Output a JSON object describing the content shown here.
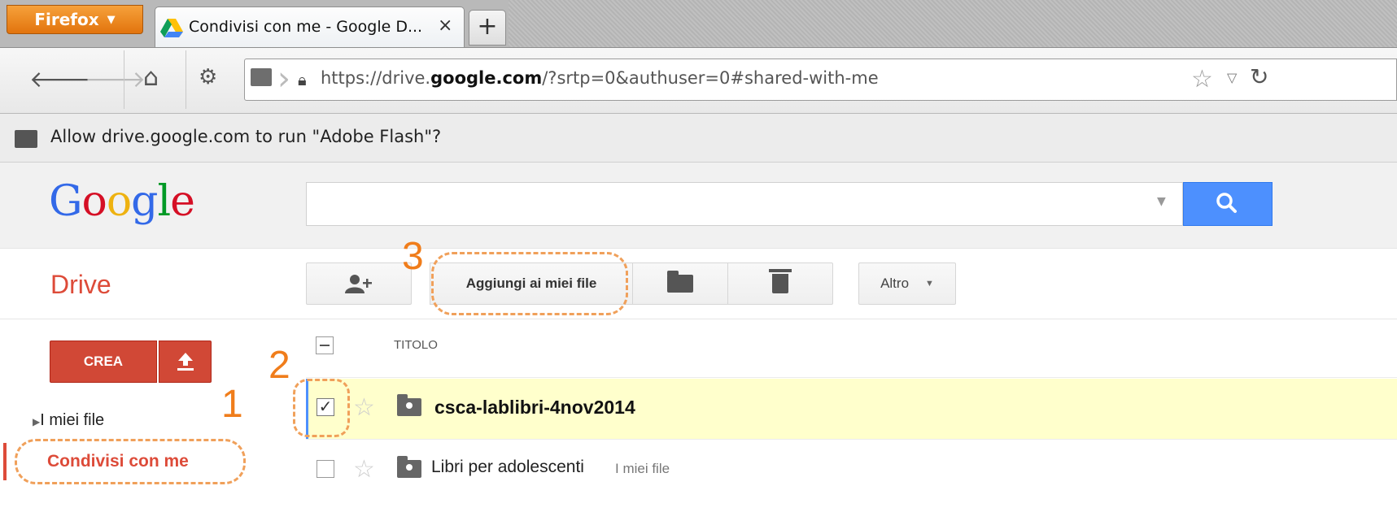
{
  "browser": {
    "menu_label": "Firefox",
    "tab_title": "Condivisi con me - Google D...",
    "tab_close": "×",
    "new_tab": "+",
    "url_prefix": "https://drive.",
    "url_domain": "google.com",
    "url_rest": "/?srtp=0&authuser=0#shared-with-me",
    "plugin_prompt": "Allow drive.google.com to run \"Adobe Flash\"?"
  },
  "google": {
    "logo_letters": [
      "G",
      "o",
      "o",
      "g",
      "l",
      "e"
    ],
    "logo_colors": [
      "#3369e8",
      "#d50f25",
      "#eeb211",
      "#3369e8",
      "#009925",
      "#d50f25"
    ]
  },
  "drive": {
    "title": "Drive",
    "toolbar": {
      "add_to_my_files": "Aggiungi ai miei file",
      "more": "Altro"
    },
    "sidebar": {
      "create": "CREA",
      "my_files": "I miei file",
      "shared_with_me": "Condivisi con me"
    },
    "list": {
      "column_title": "TITOLO",
      "rows": [
        {
          "name": "csca-lablibri-4nov2014",
          "location": "",
          "selected": true
        },
        {
          "name": "Libri per adolescenti",
          "location": "I miei file",
          "selected": false
        }
      ]
    }
  },
  "annotations": [
    "1",
    "2",
    "3"
  ],
  "colors": {
    "drive_red": "#dd4b39",
    "search_blue": "#4d90fe",
    "annotation_orange": "#f07d1b",
    "selected_row": "#ffffcc"
  }
}
